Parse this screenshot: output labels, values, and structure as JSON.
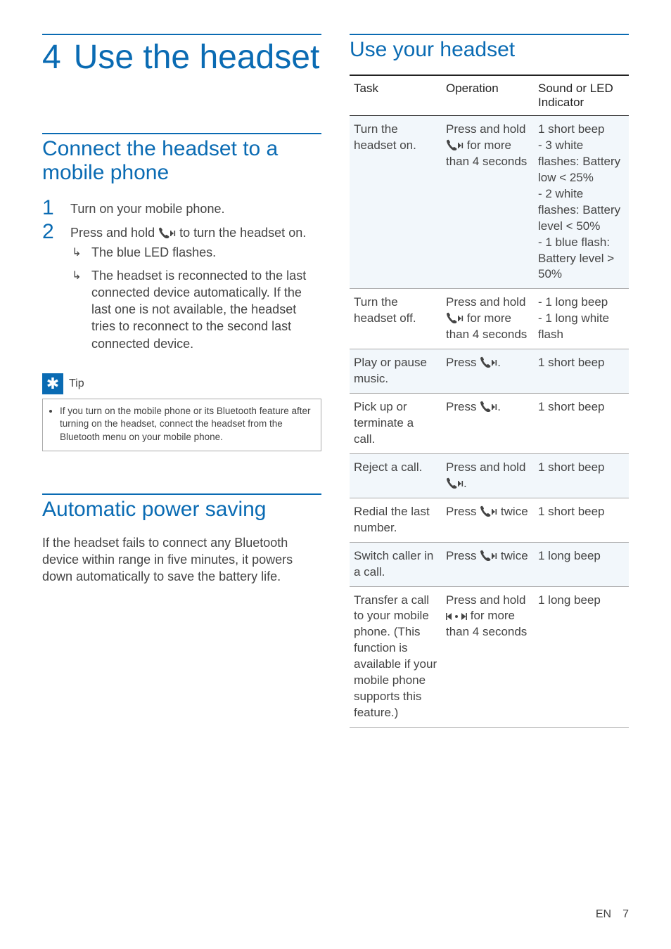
{
  "chapter": {
    "number": "4",
    "title": "Use the headset"
  },
  "left": {
    "section1": {
      "title": "Connect the headset to a mobile phone",
      "steps": {
        "s1": {
          "num": "1",
          "text": "Turn on your mobile phone."
        },
        "s2": {
          "num": "2",
          "text_before": "Press and hold ",
          "text_after": " to turn the headset on.",
          "results": {
            "r1": "The blue LED flashes.",
            "r2": "The headset is reconnected to the last connected device automatically. If the last one is not available, the headset tries to reconnect to the second last connected device."
          }
        }
      },
      "tip": {
        "label": "Tip",
        "body_before": "If you turn on the mobile phone or its ",
        "bt1": "Bluetooth",
        "body_mid1": " feature ",
        "after_word": "after",
        "body_mid2": " turning on the headset, connect the headset from the ",
        "bt2": "Bluetooth",
        "body_after": " menu on your mobile phone."
      }
    },
    "section2": {
      "title": "Automatic power saving",
      "body_before": "If the headset fails to connect any ",
      "bt": "Bluetooth",
      "body_after": " device within range in five minutes, it powers down automatically to save the battery life."
    }
  },
  "right": {
    "section_title": "Use your headset",
    "headers": {
      "task": "Task",
      "operation": "Operation",
      "indicator": "Sound or LED Indicator"
    },
    "rows": {
      "r0": {
        "task": "Turn the headset on.",
        "op_before": "Press and hold ",
        "op_after": " for more than 4 seconds",
        "ind": "1 short beep\n- 3 white flashes: Battery low < 25%\n- 2 white flashes: Battery level < 50%\n- 1 blue flash: Battery level > 50%"
      },
      "r1": {
        "task": "Turn the headset off.",
        "op_before": "Press and hold ",
        "op_after": " for more than 4 seconds",
        "ind": "- 1 long beep\n- 1 long white flash"
      },
      "r2": {
        "task": "Play or pause music.",
        "op_before": "Press ",
        "op_after": ".",
        "ind": "1 short beep"
      },
      "r3": {
        "task": "Pick up or terminate a call.",
        "op_before": "Press ",
        "op_after": ".",
        "ind": "1 short beep"
      },
      "r4": {
        "task": "Reject a call.",
        "op_before": "Press and hold ",
        "op_after": ".",
        "ind": "1 short beep"
      },
      "r5": {
        "task": "Redial the last number.",
        "op_before": "Press ",
        "op_after": " twice",
        "ind": "1 short beep"
      },
      "r6": {
        "task": "Switch caller in a call.",
        "op_before": "Press ",
        "op_after": " twice",
        "ind": "1 long beep"
      },
      "r7": {
        "task": "Transfer a call to your mobile phone. (This function is available if your mobile phone supports this feature.)",
        "op_before": "Press and hold ",
        "op_after": " for more than 4 seconds",
        "ind": "1 long beep"
      }
    }
  },
  "footer": {
    "lang": "EN",
    "page": "7"
  }
}
